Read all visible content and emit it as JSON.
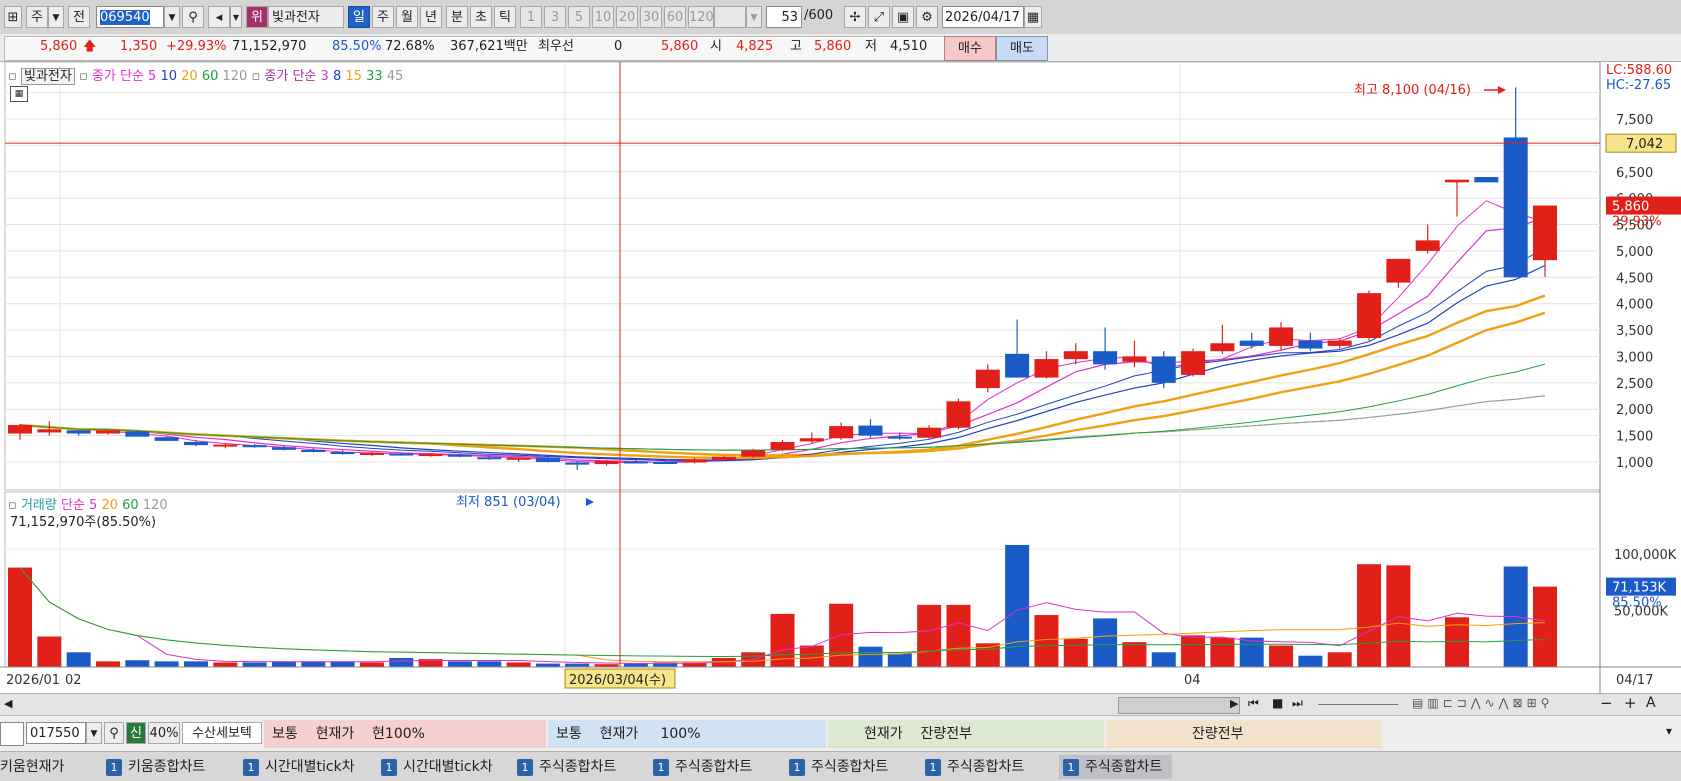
{
  "toolbar": {
    "market_prefix": "전",
    "type_select": "주",
    "code": "069540",
    "warning_badge": "위",
    "stock_name": "빛과전자",
    "periods": [
      "일",
      "주",
      "월",
      "년",
      "분",
      "초",
      "틱"
    ],
    "selected_period": "일",
    "minute_numbers": [
      "1",
      "3",
      "5",
      "10",
      "20",
      "30",
      "60",
      "120"
    ],
    "count": "53",
    "count_max": "/600",
    "date": "2026/04/17"
  },
  "quote": {
    "price": "5,860",
    "change": "1,350",
    "change_pct": "+29.93%",
    "volume": "71,152,970",
    "volume_ratio": "85.50%",
    "turnover": "72.68%",
    "amount": "367,621백만",
    "pref_label": "최우선",
    "pref_value": "0",
    "pref_price": "5,860",
    "open_label": "시",
    "open": "4,825",
    "high_label": "고",
    "high": "5,860",
    "low_label": "저",
    "low": "4,510",
    "buy_label": "매수",
    "sell_label": "매도"
  },
  "legend": {
    "name": "빛과전자",
    "ma1_label": "종가 단순",
    "ma1_periods": [
      "5",
      "10",
      "20",
      "60",
      "120"
    ],
    "ma2_label": "종가 단순",
    "ma2_periods": [
      "3",
      "8",
      "15",
      "33",
      "45"
    ],
    "volume_label": "거래량",
    "vol_ma_label": "단순",
    "vol_ma_periods": [
      "5",
      "20",
      "60",
      "120"
    ],
    "volume_info": "71,152,970주(85.50%)"
  },
  "annotations": {
    "high": "최고 8,100 (04/16)",
    "low": "최저 851 (03/04)",
    "lc": "LC:588.60",
    "hc": "HC:-27.65",
    "crosshair_price": "7,042",
    "last_price_tag": "5,860",
    "last_pct_tag": "29.93%",
    "crosshair_date": "2026/03/04(수)",
    "vol_tag": "71,153K",
    "vol_pct_tag": "85.50%"
  },
  "colors": {
    "up": "#e2201a",
    "down": "#1a5bc8",
    "ma5": "#e030c8",
    "ma10": "#2040c0",
    "ma20": "#f0a010",
    "ma60": "#20a040",
    "ma120": "#a0a0a0"
  },
  "chart_data": {
    "type": "candlestick",
    "dates_first": "2026/01/02",
    "x_labels": [
      "2026/01",
      "02",
      "04",
      "04/17"
    ],
    "price_axis": [
      "7,500",
      "6,500",
      "6,000",
      "5,500",
      "5,000",
      "4,500",
      "4,000",
      "3,500",
      "3,000",
      "2,500",
      "2,000",
      "1,500",
      "1,000"
    ],
    "volume_axis": [
      "100,000K",
      "50,000K"
    ],
    "candles": [
      [
        1540,
        1720,
        1420,
        1700
      ],
      [
        1560,
        1770,
        1500,
        1620
      ],
      [
        1600,
        1600,
        1500,
        1540
      ],
      [
        1540,
        1590,
        1520,
        1600
      ],
      [
        1580,
        1600,
        1500,
        1480
      ],
      [
        1470,
        1500,
        1410,
        1400
      ],
      [
        1380,
        1420,
        1300,
        1320
      ],
      [
        1320,
        1360,
        1260,
        1330
      ],
      [
        1320,
        1340,
        1270,
        1280
      ],
      [
        1280,
        1300,
        1220,
        1230
      ],
      [
        1230,
        1260,
        1180,
        1190
      ],
      [
        1190,
        1220,
        1140,
        1150
      ],
      [
        1150,
        1190,
        1110,
        1170
      ],
      [
        1160,
        1180,
        1120,
        1130
      ],
      [
        1120,
        1170,
        1100,
        1150
      ],
      [
        1140,
        1160,
        1090,
        1100
      ],
      [
        1090,
        1120,
        1040,
        1060
      ],
      [
        1050,
        1090,
        1000,
        1080
      ],
      [
        1080,
        1100,
        990,
        1000
      ],
      [
        990,
        1020,
        851,
        950
      ],
      [
        960,
        1040,
        930,
        1020
      ],
      [
        1010,
        1060,
        980,
        1000
      ],
      [
        1000,
        1040,
        960,
        990
      ],
      [
        990,
        1080,
        970,
        1050
      ],
      [
        1040,
        1120,
        1020,
        1100
      ],
      [
        1100,
        1250,
        1080,
        1220
      ],
      [
        1230,
        1420,
        1200,
        1380
      ],
      [
        1390,
        1560,
        1360,
        1450
      ],
      [
        1450,
        1750,
        1420,
        1680
      ],
      [
        1690,
        1810,
        1460,
        1500
      ],
      [
        1480,
        1560,
        1420,
        1460
      ],
      [
        1460,
        1700,
        1440,
        1650
      ],
      [
        1650,
        2200,
        1620,
        2150
      ],
      [
        2400,
        2850,
        2320,
        2750
      ],
      [
        3050,
        3700,
        2600,
        2600
      ],
      [
        2600,
        3100,
        2580,
        2950
      ],
      [
        2950,
        3250,
        2850,
        3100
      ],
      [
        3100,
        3550,
        2750,
        2850
      ],
      [
        2900,
        3300,
        2800,
        3000
      ],
      [
        3000,
        3100,
        2400,
        2500
      ],
      [
        2650,
        3150,
        2620,
        3100
      ],
      [
        3100,
        3600,
        3050,
        3250
      ],
      [
        3300,
        3450,
        3150,
        3200
      ],
      [
        3200,
        3650,
        3120,
        3550
      ],
      [
        3300,
        3450,
        3100,
        3150
      ],
      [
        3200,
        3350,
        3150,
        3300
      ],
      [
        3350,
        4250,
        3300,
        4200
      ],
      [
        4400,
        4700,
        4300,
        4850
      ],
      [
        5000,
        5500,
        4950,
        5200
      ],
      [
        6300,
        6350,
        5650,
        6350
      ],
      [
        6400,
        6300,
        6400,
        6300
      ],
      [
        7150,
        8100,
        4500,
        4500
      ],
      [
        4825,
        5860,
        4510,
        5860
      ]
    ],
    "volumes_k": [
      88000,
      27000,
      13000,
      5000,
      6000,
      5000,
      5000,
      4000,
      4000,
      5000,
      5000,
      5000,
      4000,
      8000,
      7000,
      5000,
      5000,
      4000,
      3000,
      3000,
      2500,
      3500,
      4000,
      4000,
      8000,
      13000,
      47000,
      19000,
      56000,
      18000,
      12000,
      55000,
      55000,
      21000,
      108000,
      46000,
      25000,
      43000,
      22000,
      13000,
      28000,
      26000,
      26000,
      19000,
      10000,
      13000,
      91000,
      90000,
      0,
      44000,
      0,
      89000,
      71153
    ]
  },
  "bottom": {
    "code": "017550",
    "new_badge": "신",
    "pct": "40%",
    "order_label": "수산세보텍",
    "panel1": [
      "보통",
      "현재가",
      "현100%"
    ],
    "panel2": [
      "보통",
      "현재가",
      "100%"
    ],
    "panel3": [
      "현재가",
      "잔량전부"
    ],
    "panel4": [
      "잔량전부"
    ]
  },
  "tabs": [
    {
      "num": "",
      "label": "키움현재가"
    },
    {
      "num": "1",
      "label": "키움종합차트"
    },
    {
      "num": "1",
      "label": "시간대별tick차"
    },
    {
      "num": "1",
      "label": "시간대별tick차"
    },
    {
      "num": "1",
      "label": "주식종합차트"
    },
    {
      "num": "1",
      "label": "주식종합차트"
    },
    {
      "num": "1",
      "label": "주식종합차트"
    },
    {
      "num": "1",
      "label": "주식종합차트"
    },
    {
      "num": "1",
      "label": "주식종합차트"
    }
  ]
}
